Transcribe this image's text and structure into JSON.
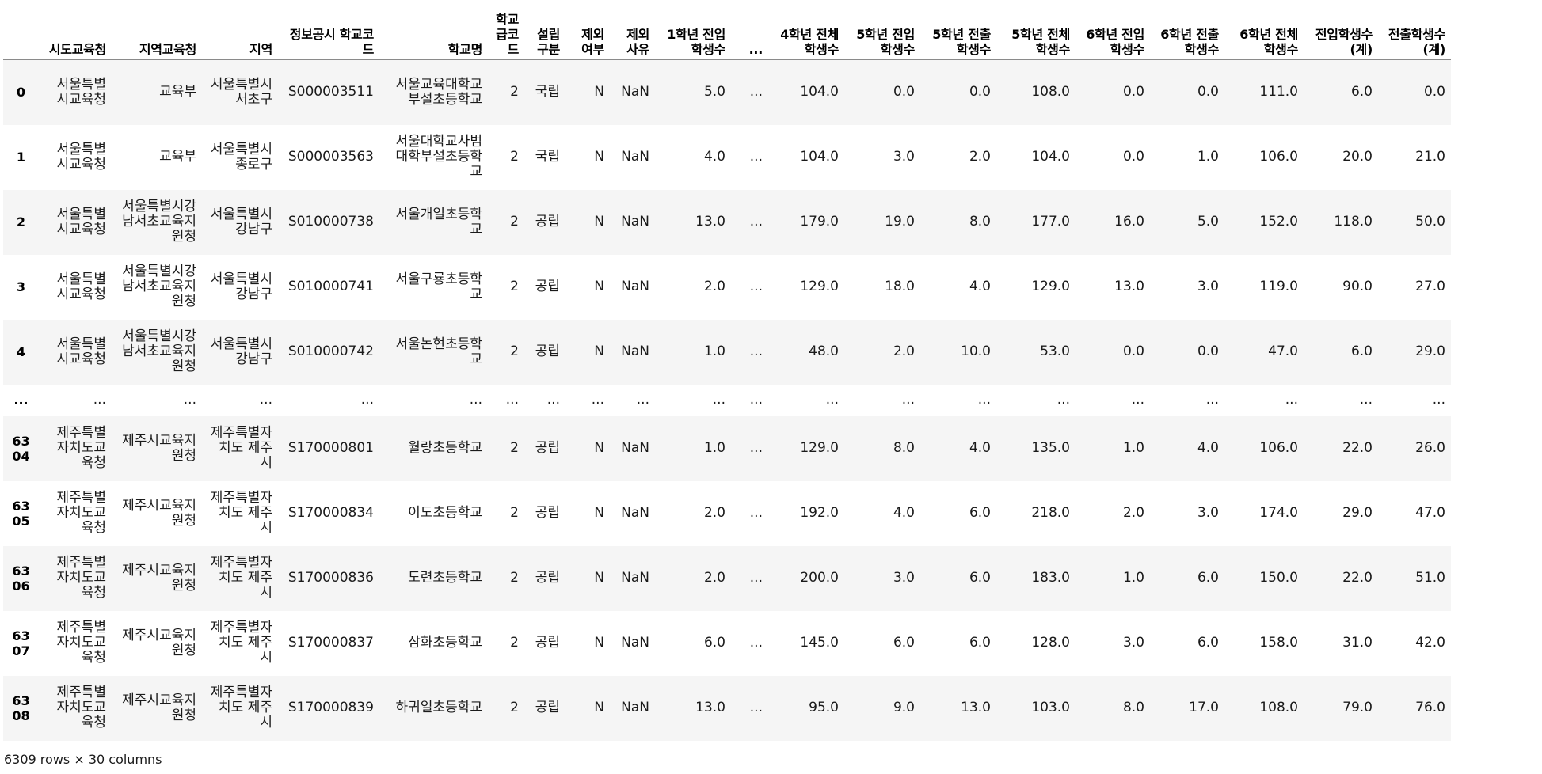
{
  "columns": [
    "",
    "시도교육청",
    "지역교육청",
    "지역",
    "정보공시 학교코드",
    "학교명",
    "학교급코드",
    "설립구분",
    "제외여부",
    "제외사유",
    "1학년 전입학생수",
    "...",
    "4학년 전체학생수",
    "5학년 전입학생수",
    "5학년 전출학생수",
    "5학년 전체학생수",
    "6학년 전입학생수",
    "6학년 전출학생수",
    "6학년 전체 학생수",
    "전입학생수(계)",
    "전출학생수(계)"
  ],
  "rows": [
    [
      "0",
      "서울특별시교육청",
      "교육부",
      "서울특별시 서초구",
      "S000003511",
      "서울교육대학교부설초등학교",
      "2",
      "국립",
      "N",
      "NaN",
      "5.0",
      "...",
      "104.0",
      "0.0",
      "0.0",
      "108.0",
      "0.0",
      "0.0",
      "111.0",
      "6.0",
      "0.0"
    ],
    [
      "1",
      "서울특별시교육청",
      "교육부",
      "서울특별시 종로구",
      "S000003563",
      "서울대학교사범대학부설초등학교",
      "2",
      "국립",
      "N",
      "NaN",
      "4.0",
      "...",
      "104.0",
      "3.0",
      "2.0",
      "104.0",
      "0.0",
      "1.0",
      "106.0",
      "20.0",
      "21.0"
    ],
    [
      "2",
      "서울특별시교육청",
      "서울특별시강남서초교육지원청",
      "서울특별시 강남구",
      "S010000738",
      "서울개일초등학교",
      "2",
      "공립",
      "N",
      "NaN",
      "13.0",
      "...",
      "179.0",
      "19.0",
      "8.0",
      "177.0",
      "16.0",
      "5.0",
      "152.0",
      "118.0",
      "50.0"
    ],
    [
      "3",
      "서울특별시교육청",
      "서울특별시강남서초교육지원청",
      "서울특별시 강남구",
      "S010000741",
      "서울구룡초등학교",
      "2",
      "공립",
      "N",
      "NaN",
      "2.0",
      "...",
      "129.0",
      "18.0",
      "4.0",
      "129.0",
      "13.0",
      "3.0",
      "119.0",
      "90.0",
      "27.0"
    ],
    [
      "4",
      "서울특별시교육청",
      "서울특별시강남서초교육지원청",
      "서울특별시 강남구",
      "S010000742",
      "서울논현초등학교",
      "2",
      "공립",
      "N",
      "NaN",
      "1.0",
      "...",
      "48.0",
      "2.0",
      "10.0",
      "53.0",
      "0.0",
      "0.0",
      "47.0",
      "6.0",
      "29.0"
    ],
    [
      "...",
      "...",
      "...",
      "...",
      "...",
      "...",
      "...",
      "...",
      "...",
      "...",
      "...",
      "...",
      "...",
      "...",
      "...",
      "...",
      "...",
      "...",
      "...",
      "...",
      "..."
    ],
    [
      "6304",
      "제주특별자치도교육청",
      "제주시교육지원청",
      "제주특별자치도 제주시",
      "S170000801",
      "월랑초등학교",
      "2",
      "공립",
      "N",
      "NaN",
      "1.0",
      "...",
      "129.0",
      "8.0",
      "4.0",
      "135.0",
      "1.0",
      "4.0",
      "106.0",
      "22.0",
      "26.0"
    ],
    [
      "6305",
      "제주특별자치도교육청",
      "제주시교육지원청",
      "제주특별자치도 제주시",
      "S170000834",
      "이도초등학교",
      "2",
      "공립",
      "N",
      "NaN",
      "2.0",
      "...",
      "192.0",
      "4.0",
      "6.0",
      "218.0",
      "2.0",
      "3.0",
      "174.0",
      "29.0",
      "47.0"
    ],
    [
      "6306",
      "제주특별자치도교육청",
      "제주시교육지원청",
      "제주특별자치도 제주시",
      "S170000836",
      "도련초등학교",
      "2",
      "공립",
      "N",
      "NaN",
      "2.0",
      "...",
      "200.0",
      "3.0",
      "6.0",
      "183.0",
      "1.0",
      "6.0",
      "150.0",
      "22.0",
      "51.0"
    ],
    [
      "6307",
      "제주특별자치도교육청",
      "제주시교육지원청",
      "제주특별자치도 제주시",
      "S170000837",
      "삼화초등학교",
      "2",
      "공립",
      "N",
      "NaN",
      "6.0",
      "...",
      "145.0",
      "6.0",
      "6.0",
      "128.0",
      "3.0",
      "6.0",
      "158.0",
      "31.0",
      "42.0"
    ],
    [
      "6308",
      "제주특별자치도교육청",
      "제주시교육지원청",
      "제주특별자치도 제주시",
      "S170000839",
      "하귀일초등학교",
      "2",
      "공립",
      "N",
      "NaN",
      "13.0",
      "...",
      "95.0",
      "9.0",
      "13.0",
      "103.0",
      "8.0",
      "17.0",
      "108.0",
      "79.0",
      "76.0"
    ]
  ],
  "shape": "6309 rows × 30 columns"
}
